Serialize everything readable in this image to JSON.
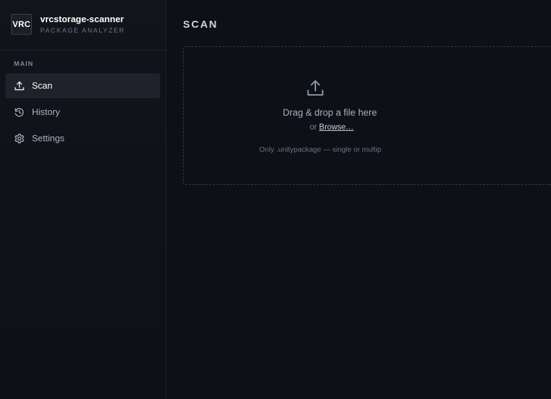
{
  "brand": {
    "logo_text": "VRC",
    "app_name": "vrcstorage-scanner",
    "subtitle": "PACKAGE ANALYZER"
  },
  "sidebar": {
    "section_label": "MAIN",
    "items": [
      {
        "label": "Scan",
        "icon": "upload-icon",
        "active": true
      },
      {
        "label": "History",
        "icon": "history-icon",
        "active": false
      },
      {
        "label": "Settings",
        "icon": "gear-icon",
        "active": false
      }
    ]
  },
  "main": {
    "title": "SCAN",
    "dropzone": {
      "icon": "upload-icon",
      "title": "Drag & drop a file here",
      "or_text": "or ",
      "browse_label": "Browse…",
      "hint": "Only .unitypackage — single or multip"
    }
  },
  "colors": {
    "background": "#0d1016",
    "sidebar_active": "#1f222a",
    "text_primary": "#ffffff",
    "text_muted": "#a9b3c1"
  }
}
